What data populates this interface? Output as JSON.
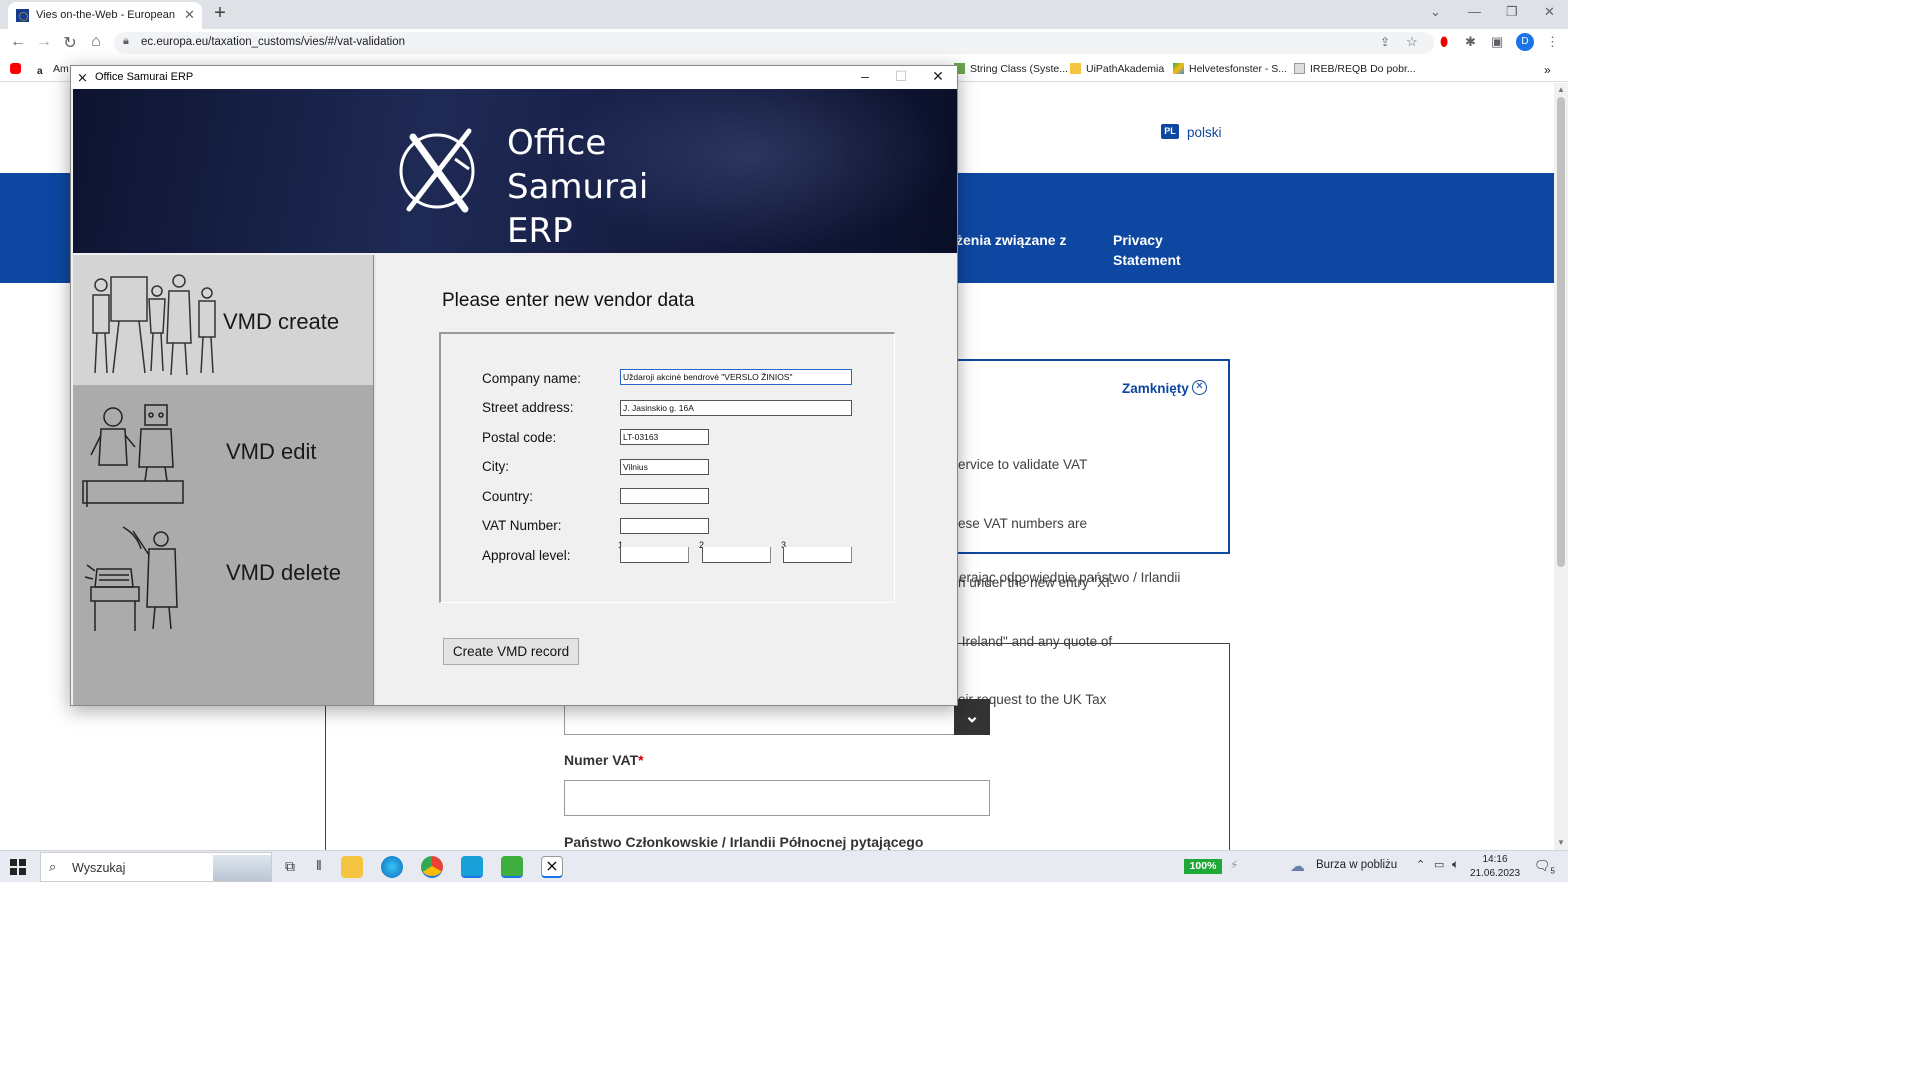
{
  "browser": {
    "tab_title": "Vies on-the-Web - European Com",
    "url": "ec.europa.eu/taxation_customs/vies/#/vat-validation",
    "profile_initial": "D",
    "bookmarks": [
      "Am",
      "String Class (Syste...",
      "UiPathAkademia",
      "Helvetesfonster - S...",
      "IREB/REQB Do pobr..."
    ]
  },
  "webpage": {
    "language_code": "PL",
    "language": "polski",
    "nav_item_partial": "żenia związane z",
    "nav_privacy": [
      "Privacy",
      "Statement"
    ],
    "notice_closed": "Zamknięty",
    "notice_lines": [
      "ervice to validate VAT",
      "ese VAT numbers are",
      "n under the new entry \"XI-",
      " Ireland\" and any quote of",
      "eir request to the UK Tax"
    ],
    "below_notice": "ierając odpowiednie państwo / Irlandii",
    "vat_label": "Numer VAT",
    "vat_required": "*",
    "member_state_label": "Państwo Członkowskie / Irlandii Północnej pytającego"
  },
  "erp": {
    "window_title": "Office Samurai ERP",
    "logo_lines": [
      "Office",
      "Samurai",
      "ERP"
    ],
    "nav": {
      "create": "VMD create",
      "edit": "VMD edit",
      "delete": "VMD delete"
    },
    "heading": "Please enter new vendor data",
    "fields": {
      "company_name": {
        "label": "Company name:",
        "value": "Uždaroji akcinė bendrovė \"VERSLO ŽINIOS\""
      },
      "street": {
        "label": "Street address:",
        "value": "J. Jasinskio g. 16A"
      },
      "postal_code": {
        "label": "Postal code:",
        "value": "LT-03163"
      },
      "city": {
        "label": "City:",
        "value": "Vilnius"
      },
      "country": {
        "label": "Country:",
        "value": ""
      },
      "vat_number": {
        "label": "VAT Number:",
        "value": ""
      },
      "approval": {
        "label": "Approval level:",
        "levels": [
          "1",
          "2",
          "3"
        ]
      }
    },
    "submit": "Create VMD record"
  },
  "taskbar": {
    "search_placeholder": "Wyszukaj",
    "battery": "100%",
    "weather": "Burza w pobliżu",
    "time": "14:16",
    "date": "21.06.2023",
    "notifications": "5"
  }
}
